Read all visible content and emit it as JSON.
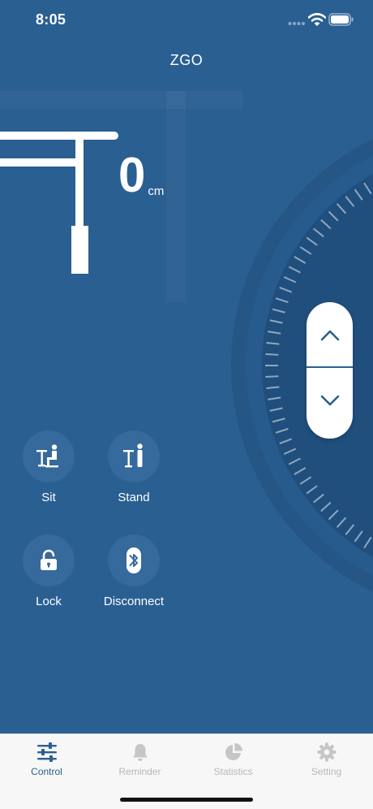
{
  "status_bar": {
    "time": "8:05"
  },
  "header": {
    "title": "ZGO"
  },
  "height": {
    "value": "0",
    "unit": "cm"
  },
  "actions": [
    {
      "label": "Sit",
      "icon": "sit-desk-icon"
    },
    {
      "label": "Stand",
      "icon": "stand-desk-icon"
    },
    {
      "label": "Lock",
      "icon": "unlock-icon"
    },
    {
      "label": "Disconnect",
      "icon": "bluetooth-icon"
    }
  ],
  "tabs": [
    {
      "label": "Control",
      "icon": "sliders-icon",
      "active": true
    },
    {
      "label": "Reminder",
      "icon": "bell-icon",
      "active": false
    },
    {
      "label": "Statistics",
      "icon": "pie-chart-icon",
      "active": false
    },
    {
      "label": "Setting",
      "icon": "gear-icon",
      "active": false
    }
  ],
  "colors": {
    "background": "#2a5f92",
    "accent": "#2a5f92",
    "tab_inactive": "#b8b8b8",
    "tab_bar": "#f7f7f7"
  }
}
